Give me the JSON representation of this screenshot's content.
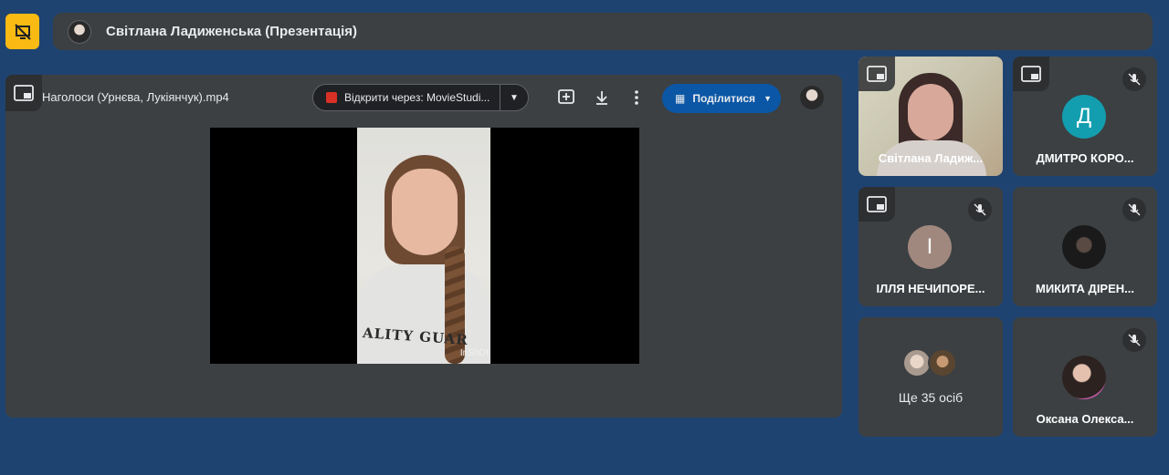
{
  "topbar": {
    "title": "Світлана Ладиженська (Презентація)",
    "left_icon": "presentation-off-icon",
    "accent": "#f9ba13"
  },
  "presentation": {
    "file_name": "Наголоси (Урнєва, Лукіянчук).mp4",
    "open_with_label": "Відкрити через: MovieStudi...",
    "share_label": "Поділитися",
    "video_watermark": "InShOt",
    "shirt_text": "ALITY GUAR",
    "share_color": "#0b57a6"
  },
  "tiles": [
    {
      "name": "Світлана Ладиж...",
      "type": "camera",
      "muted": false
    },
    {
      "name": "ДМИТРО КОРО...",
      "type": "letter",
      "letter": "Д",
      "color": "#129eaf",
      "muted": true
    },
    {
      "name": "ІЛЛЯ НЕЧИПОРЕ...",
      "type": "letter",
      "letter": "І",
      "color": "#a1887f",
      "muted": true
    },
    {
      "name": "МИКИТА ДІРЕН...",
      "type": "photo",
      "muted": true
    },
    {
      "more_label": "Ще 35 осіб",
      "type": "more"
    },
    {
      "name": "Оксана Олекса...",
      "type": "photo",
      "muted": true
    }
  ]
}
